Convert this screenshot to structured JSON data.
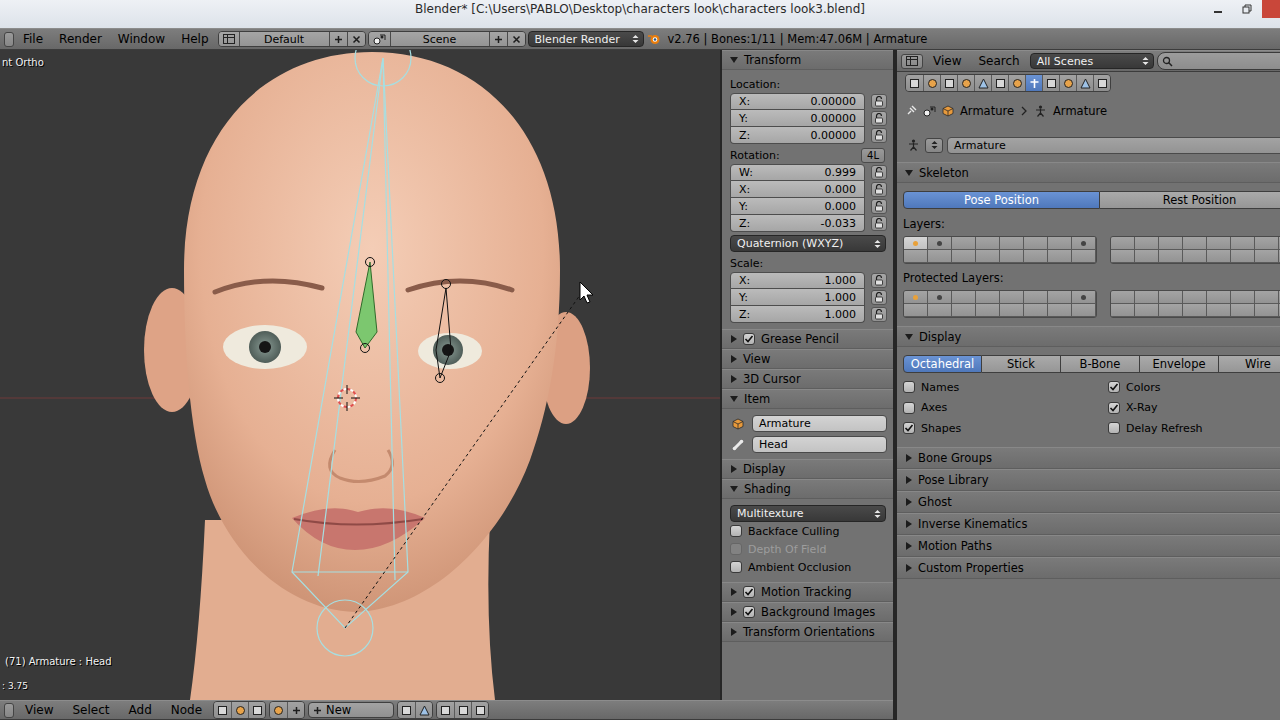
{
  "window": {
    "title": "Blender* [C:\\Users\\PABLO\\Desktop\\characters look\\characters look3.blend]"
  },
  "info_header": {
    "menus": [
      "File",
      "Render",
      "Window",
      "Help"
    ],
    "layout": "Default",
    "scene": "Scene",
    "engine": "Blender Render",
    "stats": "v2.76 | Bones:1/11 | Mem:47.06M | Armature"
  },
  "viewport": {
    "view_label": "nt Ortho",
    "object_info": "(71) Armature : Head",
    "frame_info": ": 3.75"
  },
  "n_panel": [
    {
      "kind": "transform",
      "title": "Transform",
      "expanded": true,
      "groups": [
        {
          "label": "Location:",
          "fields": [
            {
              "axis": "X:",
              "value": "0.00000",
              "locked": false
            },
            {
              "axis": "Y:",
              "value": "0.00000",
              "locked": false
            },
            {
              "axis": "Z:",
              "value": "0.00000",
              "locked": false
            }
          ]
        },
        {
          "label": "Rotation:",
          "badge": "4L",
          "mode": "Quaternion (WXYZ)",
          "fields": [
            {
              "axis": "W:",
              "value": "0.999",
              "locked": false
            },
            {
              "axis": "X:",
              "value": "0.000",
              "locked": false
            },
            {
              "axis": "Y:",
              "value": "0.000",
              "locked": false
            },
            {
              "axis": "Z:",
              "value": "-0.033",
              "locked": false
            }
          ]
        },
        {
          "label": "Scale:",
          "fields": [
            {
              "axis": "X:",
              "value": "1.000",
              "locked": false
            },
            {
              "axis": "Y:",
              "value": "1.000",
              "locked": false
            },
            {
              "axis": "Z:",
              "value": "1.000",
              "locked": false
            }
          ]
        }
      ]
    },
    {
      "kind": "header",
      "title": "Grease Pencil",
      "expanded": false,
      "checked": true
    },
    {
      "kind": "header",
      "title": "View",
      "expanded": false
    },
    {
      "kind": "header",
      "title": "3D Cursor",
      "expanded": false
    },
    {
      "kind": "item",
      "title": "Item",
      "expanded": true,
      "object": "Armature",
      "bone": "Head"
    },
    {
      "kind": "header",
      "title": "Display",
      "expanded": false
    },
    {
      "kind": "shading",
      "title": "Shading",
      "expanded": true,
      "mode": "Multitexture",
      "options": [
        {
          "label": "Backface Culling",
          "checked": false,
          "disabled": false
        },
        {
          "label": "Depth Of Field",
          "checked": false,
          "disabled": true
        },
        {
          "label": "Ambient Occlusion",
          "checked": false,
          "disabled": false
        }
      ]
    },
    {
      "kind": "header",
      "title": "Motion Tracking",
      "expanded": false,
      "checked": true
    },
    {
      "kind": "header",
      "title": "Background Images",
      "expanded": false,
      "checked": true
    },
    {
      "kind": "header",
      "title": "Transform Orientations",
      "expanded": false
    }
  ],
  "properties": {
    "menus": [
      "View",
      "Search"
    ],
    "filter": "All Scenes",
    "tabs": [
      {
        "selected": false
      },
      {
        "selected": false
      },
      {
        "selected": false
      },
      {
        "selected": false
      },
      {
        "selected": false
      },
      {
        "selected": false
      },
      {
        "selected": false
      },
      {
        "selected": true
      },
      {
        "selected": false
      },
      {
        "selected": false
      },
      {
        "selected": false
      },
      {
        "selected": false
      }
    ],
    "breadcrumb": [
      "Armature",
      "Armature"
    ],
    "datablock": "Armature",
    "panels": [
      {
        "kind": "skeleton",
        "title": "Skeleton",
        "expanded": true,
        "positions": [
          {
            "label": "Pose Position",
            "selected": true
          },
          {
            "label": "Rest Position",
            "selected": false
          }
        ],
        "layers": {
          "label": "Layers:",
          "cells": [
            {
              "used": true,
              "selected": true,
              "active": true
            },
            {
              "used": true,
              "selected": false,
              "active": false
            },
            {
              "used": false,
              "selected": false,
              "active": false
            },
            {
              "used": false,
              "selected": false,
              "active": false
            },
            {
              "used": false,
              "selected": false,
              "active": false
            },
            {
              "used": false,
              "selected": false,
              "active": false
            },
            {
              "used": false,
              "selected": false,
              "active": false
            },
            {
              "used": true,
              "selected": false,
              "active": false
            },
            {
              "used": false,
              "selected": false,
              "active": false
            },
            {
              "used": false,
              "selected": false,
              "active": false
            },
            {
              "used": false,
              "selected": false,
              "active": false
            },
            {
              "used": false,
              "selected": false,
              "active": false
            },
            {
              "used": false,
              "selected": false,
              "active": false
            },
            {
              "used": false,
              "selected": false,
              "active": false
            },
            {
              "used": false,
              "selected": false,
              "active": false
            },
            {
              "used": false,
              "selected": false,
              "active": false
            },
            {
              "used": false,
              "selected": false,
              "active": false
            },
            {
              "used": false,
              "selected": false,
              "active": false
            },
            {
              "used": false,
              "selected": false,
              "active": false
            },
            {
              "used": false,
              "selected": false,
              "active": false
            },
            {
              "used": false,
              "selected": false,
              "active": false
            },
            {
              "used": false,
              "selected": false,
              "active": false
            },
            {
              "used": false,
              "selected": false,
              "active": false
            },
            {
              "used": false,
              "selected": false,
              "active": false
            },
            {
              "used": false,
              "selected": false,
              "active": false
            },
            {
              "used": false,
              "selected": false,
              "active": false
            },
            {
              "used": false,
              "selected": false,
              "active": false
            },
            {
              "used": false,
              "selected": false,
              "active": false
            },
            {
              "used": false,
              "selected": false,
              "active": false
            },
            {
              "used": false,
              "selected": false,
              "active": false
            },
            {
              "used": false,
              "selected": false,
              "active": false
            },
            {
              "used": false,
              "selected": false,
              "active": false
            }
          ]
        },
        "protected": {
          "label": "Protected Layers:",
          "cells": [
            {
              "used": true,
              "selected": false,
              "active": true
            },
            {
              "used": true,
              "selected": false,
              "active": false
            },
            {
              "used": false,
              "selected": false,
              "active": false
            },
            {
              "used": false,
              "selected": false,
              "active": false
            },
            {
              "used": false,
              "selected": false,
              "active": false
            },
            {
              "used": false,
              "selected": false,
              "active": false
            },
            {
              "used": false,
              "selected": false,
              "active": false
            },
            {
              "used": true,
              "selected": false,
              "active": false
            },
            {
              "used": false,
              "selected": false,
              "active": false
            },
            {
              "used": false,
              "selected": false,
              "active": false
            },
            {
              "used": false,
              "selected": false,
              "active": false
            },
            {
              "used": false,
              "selected": false,
              "active": false
            },
            {
              "used": false,
              "selected": false,
              "active": false
            },
            {
              "used": false,
              "selected": false,
              "active": false
            },
            {
              "used": false,
              "selected": false,
              "active": false
            },
            {
              "used": false,
              "selected": false,
              "active": false
            },
            {
              "used": false,
              "selected": false,
              "active": false
            },
            {
              "used": false,
              "selected": false,
              "active": false
            },
            {
              "used": false,
              "selected": false,
              "active": false
            },
            {
              "used": false,
              "selected": false,
              "active": false
            },
            {
              "used": false,
              "selected": false,
              "active": false
            },
            {
              "used": false,
              "selected": false,
              "active": false
            },
            {
              "used": false,
              "selected": false,
              "active": false
            },
            {
              "used": false,
              "selected": false,
              "active": false
            },
            {
              "used": false,
              "selected": false,
              "active": false
            },
            {
              "used": false,
              "selected": false,
              "active": false
            },
            {
              "used": false,
              "selected": false,
              "active": false
            },
            {
              "used": false,
              "selected": false,
              "active": false
            },
            {
              "used": false,
              "selected": false,
              "active": false
            },
            {
              "used": false,
              "selected": false,
              "active": false
            },
            {
              "used": false,
              "selected": false,
              "active": false
            },
            {
              "used": false,
              "selected": false,
              "active": false
            }
          ]
        }
      },
      {
        "kind": "display",
        "title": "Display",
        "expanded": true,
        "types": [
          {
            "label": "Octahedral",
            "selected": true
          },
          {
            "label": "Stick",
            "selected": false
          },
          {
            "label": "B-Bone",
            "selected": false
          },
          {
            "label": "Envelope",
            "selected": false
          },
          {
            "label": "Wire",
            "selected": false
          }
        ],
        "options": [
          {
            "label": "Names",
            "checked": false
          },
          {
            "label": "Colors",
            "checked": true
          },
          {
            "label": "Axes",
            "checked": false
          },
          {
            "label": "X-Ray",
            "checked": true
          },
          {
            "label": "Shapes",
            "checked": true
          },
          {
            "label": "Delay Refresh",
            "checked": false
          }
        ]
      },
      {
        "kind": "header",
        "title": "Bone Groups",
        "expanded": false
      },
      {
        "kind": "header",
        "title": "Pose Library",
        "expanded": false
      },
      {
        "kind": "header",
        "title": "Ghost",
        "expanded": false
      },
      {
        "kind": "header",
        "title": "Inverse Kinematics",
        "expanded": false
      },
      {
        "kind": "header",
        "title": "Motion Paths",
        "expanded": false
      },
      {
        "kind": "header",
        "title": "Custom Properties",
        "expanded": false
      }
    ]
  },
  "bottom_bar": {
    "menus": [
      "View",
      "Select",
      "Add",
      "Node"
    ],
    "new_button": "New"
  }
}
